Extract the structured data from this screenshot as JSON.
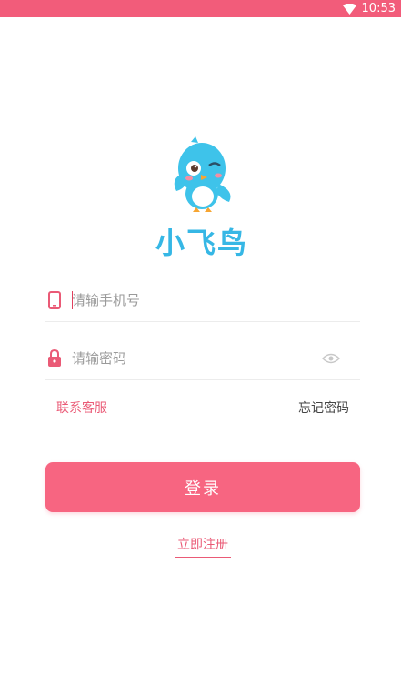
{
  "status_bar": {
    "time": "10:53",
    "wifi_icon": "wifi-icon",
    "background": "#f25c7a"
  },
  "logo": {
    "app_name": "小飞鸟",
    "name_color": "#36b7e5",
    "bird_color": "#3ec3ea"
  },
  "login_form": {
    "phone": {
      "placeholder": "请输手机号",
      "icon": "phone-icon",
      "value": ""
    },
    "password": {
      "placeholder": "请输密码",
      "icon": "lock-icon",
      "toggle_icon": "eye-icon",
      "value": ""
    }
  },
  "links": {
    "contact_support": "联系客服",
    "forgot_password": "忘记密码"
  },
  "login_button": {
    "label": "登录",
    "color": "#f76581"
  },
  "register_link": {
    "label": "立即注册"
  },
  "accent_color": "#ea5a76"
}
